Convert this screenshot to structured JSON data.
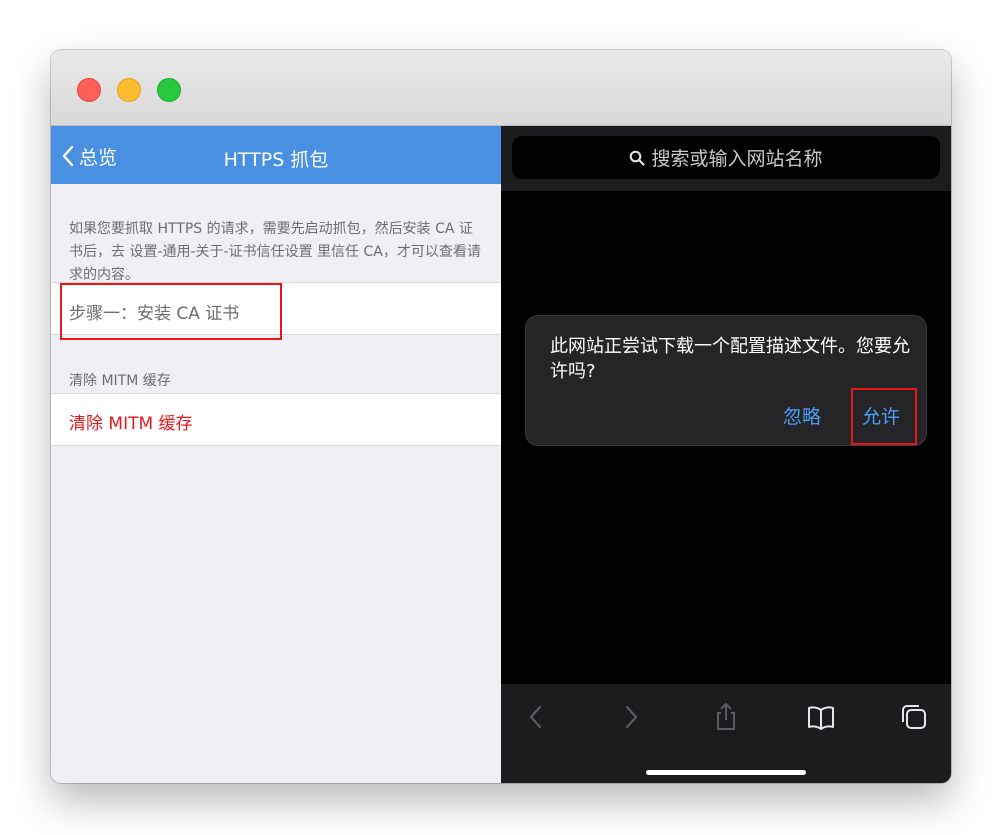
{
  "left": {
    "nav": {
      "back_label": "总览",
      "title": "HTTPS 抓包"
    },
    "description": "如果您要抓取 HTTPS 的请求，需要先启动抓包，然后安装 CA 证书后，去 设置-通用-关于-证书信任设置 里信任 CA，才可以查看请求的内容。",
    "step_row_label": "步骤一：安装 CA 证书",
    "mitm_section_header": "清除 MITM 缓存",
    "mitm_clear_label": "清除 MITM 缓存"
  },
  "right": {
    "search_placeholder": "搜索或输入网站名称",
    "alert": {
      "message": "此网站正尝试下载一个配置描述文件。您要允许吗?",
      "ignore_label": "忽略",
      "allow_label": "允许"
    },
    "toolbar": {
      "icons": [
        "back-arrow-icon",
        "forward-arrow-icon",
        "share-icon",
        "bookmarks-icon",
        "tabs-icon"
      ]
    }
  },
  "colors": {
    "nav_blue": "#4a90e2",
    "destructive_red": "#e8171a",
    "ios_link_blue": "#4a9df8",
    "highlight_box": "#e8171a"
  }
}
